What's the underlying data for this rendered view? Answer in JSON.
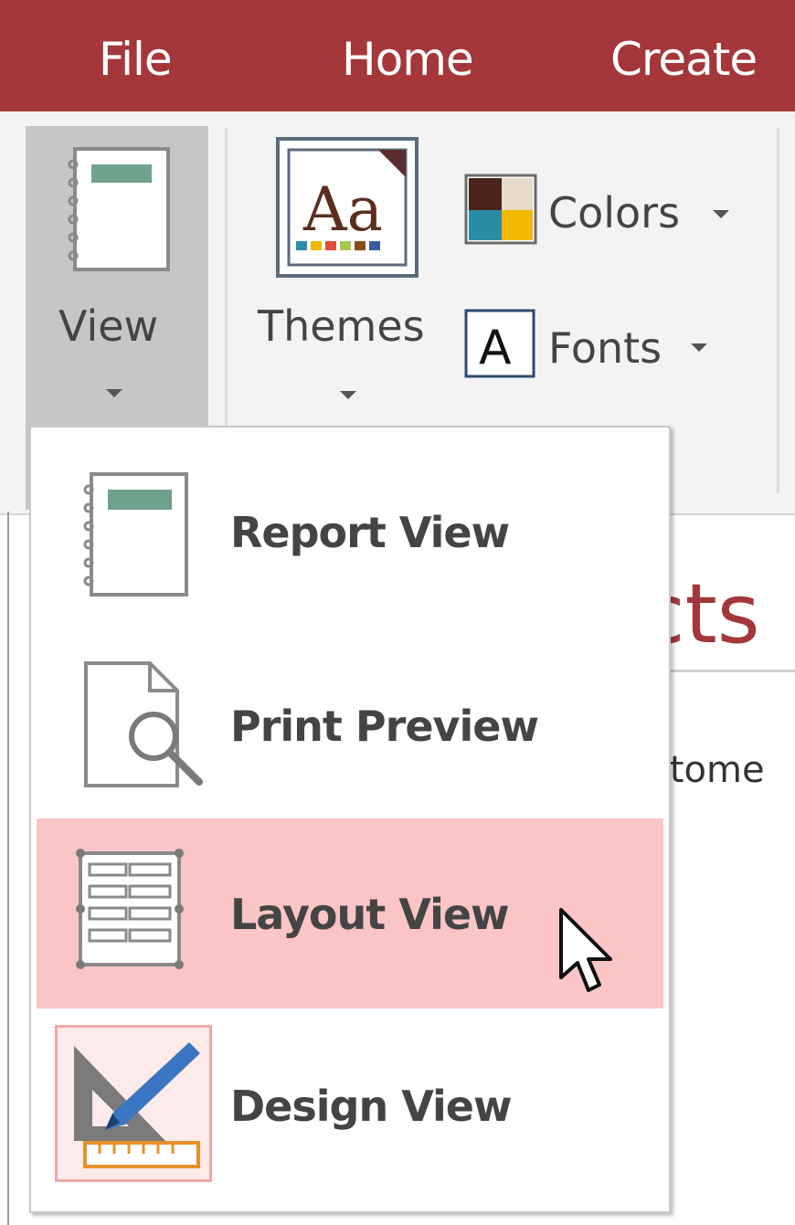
{
  "tabs": [
    {
      "label": "File"
    },
    {
      "label": "Home"
    },
    {
      "label": "Create"
    }
  ],
  "ribbon": {
    "view_label": "View",
    "themes_label": "Themes",
    "colors_label": "Colors",
    "fonts_label": "Fonts",
    "fonts_icon_glyph": "A",
    "themes_icon_glyph": "Aa"
  },
  "document": {
    "title_fragment": "cts",
    "sub_fragment": "stome"
  },
  "menu": {
    "items": [
      {
        "label": "Report View",
        "icon": "report-view-icon",
        "highlighted": false
      },
      {
        "label": "Print Preview",
        "icon": "print-preview-icon",
        "highlighted": false
      },
      {
        "label": "Layout View",
        "icon": "layout-view-icon",
        "highlighted": true
      },
      {
        "label": "Design View",
        "icon": "design-view-icon",
        "highlighted": false
      }
    ]
  },
  "colors": {
    "accent": "#a4373a",
    "highlight": "#fbc5c6",
    "ribbon_bg": "#f3f3f3",
    "view_button_bg": "#c6c6c6"
  }
}
